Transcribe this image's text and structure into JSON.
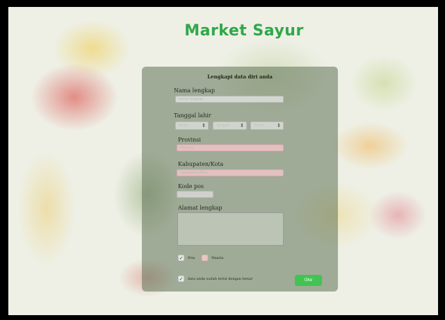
{
  "app": {
    "title": "Market Sayur"
  },
  "form": {
    "heading": "Lengkapi data diri anda",
    "nama": {
      "label": "Nama lengkap",
      "placeholder": "nama lengkap"
    },
    "tanggal": {
      "label": "Tanggal lahir",
      "bulan": "Bulan",
      "hari": "Tanggal",
      "tahun": "Tahun"
    },
    "provinsi": {
      "label": "Provinsi",
      "placeholder": "Provinsi"
    },
    "kabupaten": {
      "label": "Kabupaten/Kota",
      "placeholder": "Kabupaten/Kota"
    },
    "kodepos": {
      "label": "Kode pos",
      "placeholder": ""
    },
    "alamat": {
      "label": "Alamat lengkap"
    },
    "gender": {
      "pria_label": "Pria",
      "pria_checked": true,
      "wanita_label": "Wanita",
      "wanita_checked": false
    },
    "confirm": {
      "label": "data anda sudah terisi dengan benar",
      "checked": true
    },
    "submit_label": "Oke"
  },
  "colors": {
    "title": "#2fa84a",
    "button": "#41c452",
    "card": "rgba(95,115,85,0.55)"
  },
  "icons": {
    "select_arrow": "updown-chevron-icon",
    "checkmark": "check-icon"
  }
}
